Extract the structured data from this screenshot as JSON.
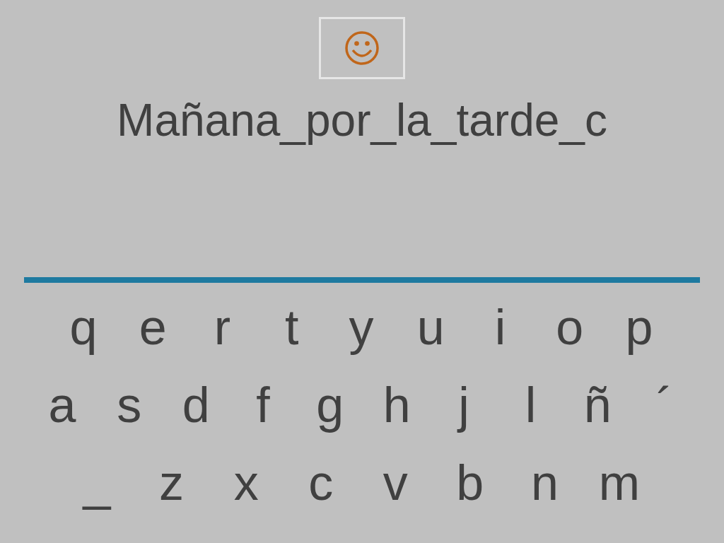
{
  "answer": {
    "text": "Mañana_por_la_tarde_c"
  },
  "keyboard": {
    "rows": [
      [
        "q",
        "e",
        "r",
        "t",
        "y",
        "u",
        "i",
        "o",
        "p"
      ],
      [
        "a",
        "s",
        "d",
        "f",
        "g",
        "h",
        "j",
        "l",
        "ñ",
        "´"
      ],
      [
        "_",
        "z",
        "x",
        "c",
        "v",
        "b",
        "n",
        "m"
      ]
    ]
  }
}
